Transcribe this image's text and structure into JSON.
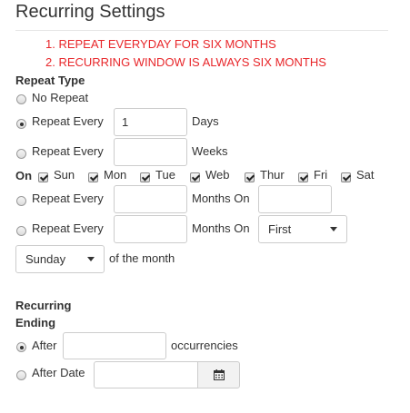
{
  "header": {
    "title": "Recurring Settings"
  },
  "notes": [
    "1. REPEAT EVERYDAY FOR SIX MONTHS",
    "2. RECURRING WINDOW IS ALWAYS SIX MONTHS"
  ],
  "repeat_type": {
    "heading": "Repeat Type",
    "no_repeat": {
      "label": "No Repeat",
      "selected": false
    },
    "days": {
      "label": "Repeat Every",
      "value": "1",
      "unit": "Days",
      "selected": true
    },
    "weeks": {
      "label": "Repeat Every",
      "value": "",
      "unit": "Weeks",
      "selected": false
    },
    "on_label": "On",
    "weekdays": [
      {
        "label": "Sun",
        "checked": true
      },
      {
        "label": "Mon",
        "checked": true
      },
      {
        "label": "Tue",
        "checked": true
      },
      {
        "label": "Web",
        "checked": true
      },
      {
        "label": "Thur",
        "checked": true
      },
      {
        "label": "Fri",
        "checked": true
      },
      {
        "label": "Sat",
        "checked": true
      }
    ],
    "months_on_day": {
      "label": "Repeat Every",
      "value": "",
      "unit": "Months On",
      "day_value": "",
      "selected": false
    },
    "months_on_week": {
      "label": "Repeat Every",
      "value": "",
      "unit": "Months On",
      "week_select": "First",
      "selected": false
    },
    "day_select": "Sunday",
    "of_the_month": "of the month"
  },
  "ending": {
    "heading_line1": "Recurring",
    "heading_line2": "Ending",
    "after": {
      "label": "After",
      "value": "",
      "unit": "occurrencies",
      "selected": true
    },
    "after_date": {
      "label": "After Date",
      "value": "",
      "selected": false
    }
  }
}
